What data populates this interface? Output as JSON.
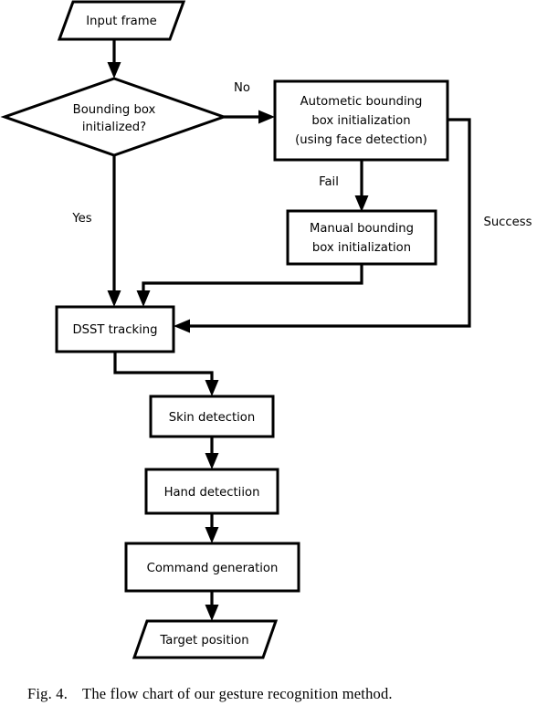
{
  "figure": {
    "caption_label": "Fig. 4.",
    "caption_text": "The flow chart of our gesture recognition method.",
    "caption_full": "Fig. 4.    The flow chart of our gesture recognition method."
  },
  "chart_data": {
    "type": "diagram",
    "diagram_kind": "flowchart",
    "title": "The flow chart of our gesture recognition method.",
    "orientation": "top-to-bottom",
    "stroke_color": "#000000",
    "fill_color": "#ffffff",
    "nodes": [
      {
        "id": "input_frame",
        "shape": "parallelogram",
        "label": "Input frame"
      },
      {
        "id": "bbox_initialized",
        "shape": "diamond",
        "label": "Bounding box initialized?",
        "lines": [
          "Bounding box",
          "initialized?"
        ]
      },
      {
        "id": "auto_init",
        "shape": "rectangle",
        "label": "Autometic bounding box initialization (using face detection)",
        "lines": [
          "Autometic bounding",
          "box initialization",
          "(using face detection)"
        ]
      },
      {
        "id": "manual_init",
        "shape": "rectangle",
        "label": "Manual bounding box initialization",
        "lines": [
          "Manual bounding",
          "box initialization"
        ]
      },
      {
        "id": "dsst_tracking",
        "shape": "rectangle",
        "label": "DSST tracking"
      },
      {
        "id": "skin_detection",
        "shape": "rectangle",
        "label": "Skin detection"
      },
      {
        "id": "hand_detection",
        "shape": "rectangle",
        "label": "Hand detectiion"
      },
      {
        "id": "command_generation",
        "shape": "rectangle",
        "label": "Command generation"
      },
      {
        "id": "target_position",
        "shape": "parallelogram",
        "label": "Target position"
      }
    ],
    "edges": [
      {
        "from": "input_frame",
        "to": "bbox_initialized",
        "label": ""
      },
      {
        "from": "bbox_initialized",
        "to": "auto_init",
        "label": "No"
      },
      {
        "from": "bbox_initialized",
        "to": "dsst_tracking",
        "label": "Yes"
      },
      {
        "from": "auto_init",
        "to": "manual_init",
        "label": "Fail"
      },
      {
        "from": "auto_init",
        "to": "dsst_tracking",
        "label": "Success"
      },
      {
        "from": "manual_init",
        "to": "dsst_tracking",
        "label": ""
      },
      {
        "from": "dsst_tracking",
        "to": "skin_detection",
        "label": ""
      },
      {
        "from": "skin_detection",
        "to": "hand_detection",
        "label": ""
      },
      {
        "from": "hand_detection",
        "to": "command_generation",
        "label": ""
      },
      {
        "from": "command_generation",
        "to": "target_position",
        "label": ""
      }
    ]
  },
  "nodes": {
    "input_frame": {
      "label": "Input frame"
    },
    "bbox_initialized": {
      "line1": "Bounding box",
      "line2": "initialized?"
    },
    "auto_init": {
      "line1": "Autometic bounding",
      "line2": "box initialization",
      "line3": "(using face detection)"
    },
    "manual_init": {
      "line1": "Manual bounding",
      "line2": "box initialization"
    },
    "dsst_tracking": {
      "label": "DSST tracking"
    },
    "skin_detection": {
      "label": "Skin detection"
    },
    "hand_detection": {
      "label": "Hand detectiion"
    },
    "command_generation": {
      "label": "Command generation"
    },
    "target_position": {
      "label": "Target position"
    }
  },
  "edge_labels": {
    "no": "No",
    "yes": "Yes",
    "fail": "Fail",
    "success": "Success"
  }
}
